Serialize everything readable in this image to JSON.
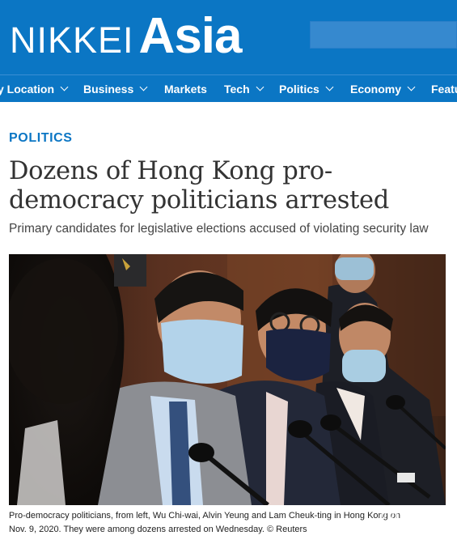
{
  "header": {
    "logo_part1": "NIKKEI",
    "logo_part2": "Asia",
    "brand_color": "#0b76c4"
  },
  "nav": {
    "items": [
      {
        "label": "y Location",
        "has_dropdown": true
      },
      {
        "label": "Business",
        "has_dropdown": true
      },
      {
        "label": "Markets",
        "has_dropdown": false
      },
      {
        "label": "Tech",
        "has_dropdown": true
      },
      {
        "label": "Politics",
        "has_dropdown": true
      },
      {
        "label": "Economy",
        "has_dropdown": true
      },
      {
        "label": "Featu",
        "has_dropdown": false
      }
    ]
  },
  "article": {
    "section": "POLITICS",
    "headline": "Dozens of Hong Kong pro-democracy politicians arrested",
    "subhead": "Primary candidates for legislative elections accused of violating security law",
    "caption_line1": "Pro-democracy politicians, from left, Wu Chi-wai, Alvin Yeung and Lam Cheuk-ting in Hong Kong on",
    "caption_line2": "Nov. 9, 2020. They were among dozens arrested on Wednesday.   © Reuters"
  },
  "watermark": "mnyOu"
}
